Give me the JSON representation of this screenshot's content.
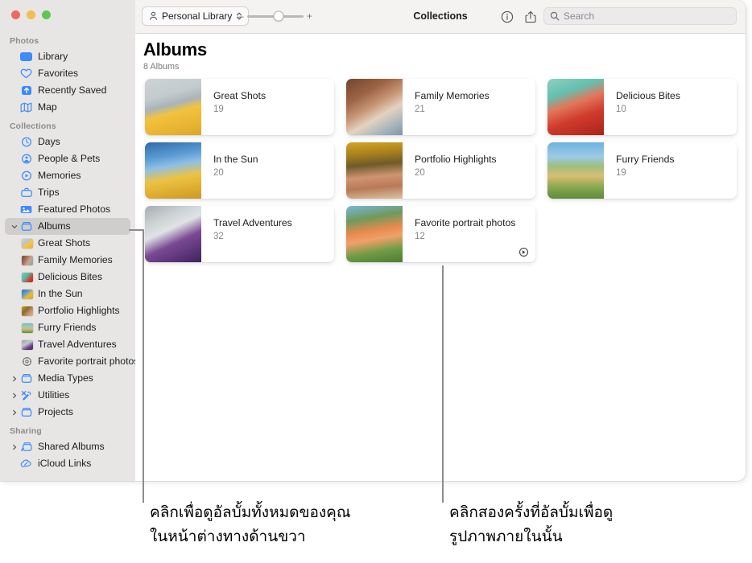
{
  "window": {
    "traffic_lights": [
      "close",
      "minimize",
      "zoom"
    ],
    "colors": {
      "sidebar_bg": "#e7e6e5",
      "toolbar_bg": "#f4f3f2",
      "content_bg": "#ffffff",
      "accent_blue": "#3d8bfd",
      "selected_row": "#cfcecd",
      "callout_line": "#8d8d8d"
    }
  },
  "toolbar": {
    "library_button": {
      "label": "Personal Library",
      "icon": "person-icon",
      "chevron": "chevron-up-down-icon"
    },
    "zoom_slider": {
      "minus": "–",
      "plus": "+",
      "value_pct": 56
    },
    "title": "Collections",
    "info_icon": "info-circle-icon",
    "share_icon": "share-icon",
    "search": {
      "icon": "search-icon",
      "placeholder": "Search",
      "value": ""
    }
  },
  "sidebar": {
    "sections": [
      {
        "title": "Photos",
        "items": [
          {
            "label": "Library",
            "icon": "library-icon"
          },
          {
            "label": "Favorites",
            "icon": "heart-icon"
          },
          {
            "label": "Recently Saved",
            "icon": "recently-saved-icon"
          },
          {
            "label": "Map",
            "icon": "map-icon"
          }
        ]
      },
      {
        "title": "Collections",
        "items": [
          {
            "label": "Days",
            "icon": "clock-icon"
          },
          {
            "label": "People & Pets",
            "icon": "people-icon"
          },
          {
            "label": "Memories",
            "icon": "memories-icon"
          },
          {
            "label": "Trips",
            "icon": "trips-icon"
          },
          {
            "label": "Featured Photos",
            "icon": "featured-photos-icon"
          },
          {
            "label": "Albums",
            "icon": "album-icon",
            "disclosure": "expanded",
            "selected": true
          },
          {
            "label": "Great Shots",
            "icon": "album-thumb-icon",
            "sub": true
          },
          {
            "label": "Family Memories",
            "icon": "album-thumb-icon",
            "sub": true
          },
          {
            "label": "Delicious Bites",
            "icon": "album-thumb-icon",
            "sub": true
          },
          {
            "label": "In the Sun",
            "icon": "album-thumb-icon",
            "sub": true
          },
          {
            "label": "Portfolio Highlights",
            "icon": "album-thumb-icon",
            "sub": true
          },
          {
            "label": "Furry Friends",
            "icon": "album-thumb-icon",
            "sub": true
          },
          {
            "label": "Travel Adventures",
            "icon": "album-thumb-icon",
            "sub": true
          },
          {
            "label": "Favorite portrait photos",
            "icon": "gear-icon",
            "sub": true
          },
          {
            "label": "Media Types",
            "icon": "album-icon",
            "disclosure": "collapsed"
          },
          {
            "label": "Utilities",
            "icon": "utilities-icon",
            "disclosure": "collapsed"
          },
          {
            "label": "Projects",
            "icon": "album-icon",
            "disclosure": "collapsed"
          }
        ]
      },
      {
        "title": "Sharing",
        "items": [
          {
            "label": "Shared Albums",
            "icon": "shared-album-icon",
            "disclosure": "collapsed"
          },
          {
            "label": "iCloud Links",
            "icon": "icloud-link-icon"
          }
        ]
      }
    ]
  },
  "main": {
    "heading": "Albums",
    "subheading": "8 Albums",
    "albums": [
      {
        "title": "Great Shots",
        "count": "19"
      },
      {
        "title": "Family Memories",
        "count": "21"
      },
      {
        "title": "Delicious Bites",
        "count": "10"
      },
      {
        "title": "In the Sun",
        "count": "20"
      },
      {
        "title": "Portfolio Highlights",
        "count": "20"
      },
      {
        "title": "Furry Friends",
        "count": "19"
      },
      {
        "title": "Travel Adventures",
        "count": "32"
      },
      {
        "title": "Favorite portrait photos",
        "count": "12",
        "badge": "smart-album-gear-icon"
      }
    ]
  },
  "annotations": [
    {
      "text": "คลิกเพื่อดูอัลบั้มทั้งหมดของคุณ\nในหน้าต่างทางด้านขวา"
    },
    {
      "text": "คลิกสองครั้งที่อัลบั้มเพื่อดู\nรูปภาพภายในนั้น"
    }
  ]
}
